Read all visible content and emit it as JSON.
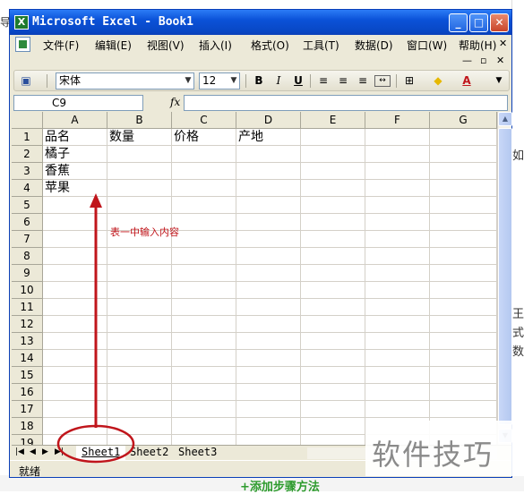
{
  "window": {
    "title": "Microsoft Excel - Book1",
    "minimize": "_",
    "maximize": "□",
    "close": "✕"
  },
  "menu": {
    "items": [
      "文件(F)",
      "编辑(E)",
      "视图(V)",
      "插入(I)",
      "格式(O)",
      "工具(T)",
      "数据(D)",
      "窗口(W)",
      "帮助(H)"
    ],
    "doc_close": "✕",
    "doc_restore": "ㅂ",
    "doc_minimize": "✕"
  },
  "toolbar": {
    "font_name": "宋体",
    "font_size": "12",
    "bold": "B",
    "italic": "I",
    "underline": "U"
  },
  "formula_bar": {
    "name_box": "C9",
    "fx": "fx",
    "value": ""
  },
  "columns": [
    "A",
    "B",
    "C",
    "D",
    "E",
    "F",
    "G"
  ],
  "rows": [
    "1",
    "2",
    "3",
    "4",
    "5",
    "6",
    "7",
    "8",
    "9",
    "10",
    "11",
    "12",
    "13",
    "14",
    "15",
    "16",
    "17",
    "18",
    "19"
  ],
  "cells": {
    "A1": "品名",
    "B1": "数量",
    "C1": "价格",
    "D1": "产地",
    "A2": "橘子",
    "A3": "香蕉",
    "A4": "苹果"
  },
  "sheets": {
    "nav_first": "|◀",
    "nav_prev": "◀",
    "nav_next": "▶",
    "nav_last": "▶|",
    "tabs": [
      "Sheet1",
      "Sheet2",
      "Sheet3"
    ],
    "active": "Sheet1"
  },
  "status": "就绪",
  "annotation": {
    "text": "表一中输入内容",
    "color": "#c0151b"
  },
  "background": {
    "left_char": "导",
    "right_chars": [
      "如",
      "王",
      "式",
      "数"
    ],
    "add_step": "+添加步骤方法"
  },
  "watermark": "软件技巧",
  "colors": {
    "titlebar": "#0b52d8",
    "chrome": "#ece9d8",
    "accent_red": "#c0151b"
  }
}
